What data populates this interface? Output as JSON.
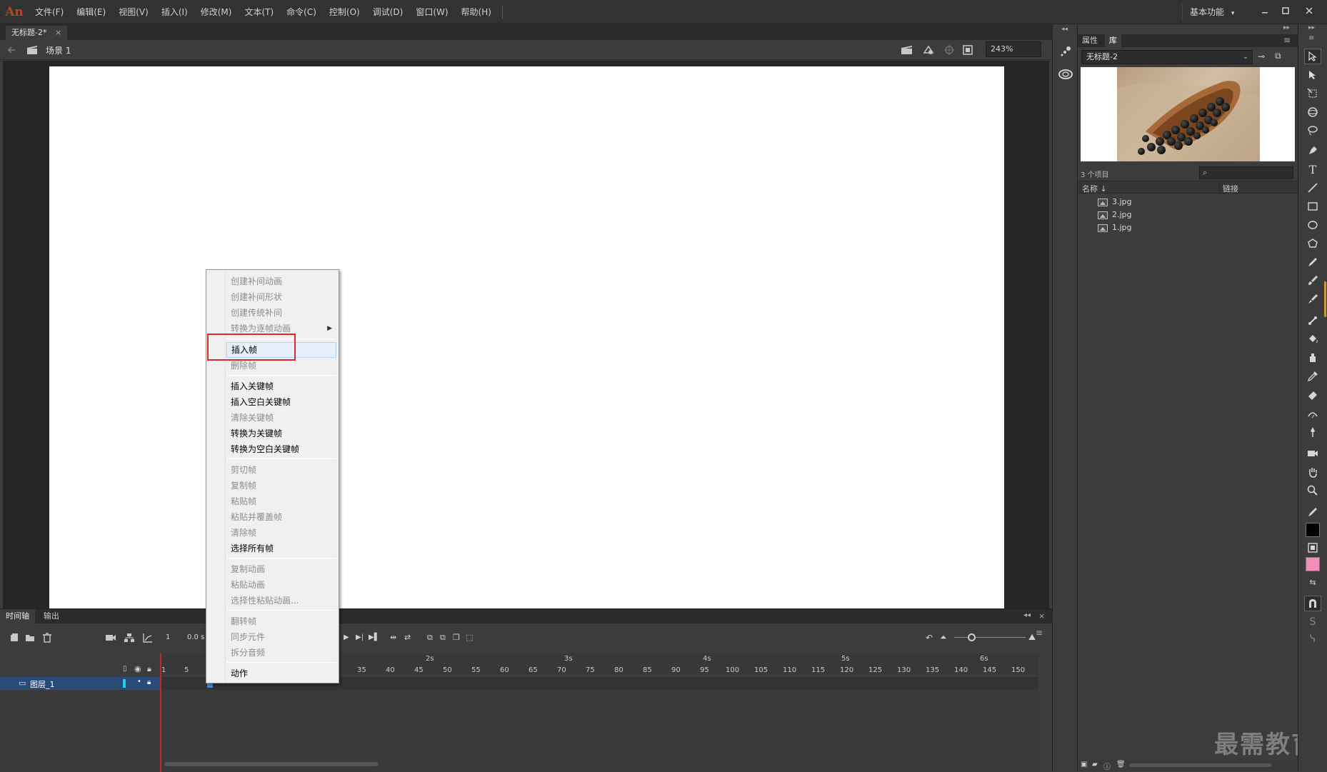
{
  "app": {
    "logo": "An",
    "accent": "#b7452c"
  },
  "menubar": {
    "items": [
      "文件(F)",
      "编辑(E)",
      "视图(V)",
      "插入(I)",
      "修改(M)",
      "文本(T)",
      "命令(C)",
      "控制(O)",
      "调试(D)",
      "窗口(W)",
      "帮助(H)"
    ],
    "workspace": "基本功能",
    "workspace_arrow": "▾"
  },
  "document": {
    "tab_title": "无标题-2*",
    "tab_close": "×",
    "scene_label": "场景 1",
    "zoom": "243%"
  },
  "timeline": {
    "tabs": [
      "时间轴",
      "输出"
    ],
    "current_frame": "1",
    "fps_time": "0.0 s",
    "layer_name": "图层_1",
    "ruler_numbers": [
      "1",
      "5",
      "35",
      "40",
      "45",
      "50",
      "55",
      "60",
      "65",
      "70",
      "75",
      "80",
      "85",
      "90",
      "95",
      "100",
      "105",
      "110",
      "115",
      "120",
      "125",
      "130",
      "135",
      "140",
      "145",
      "150"
    ],
    "ruler_seconds": [
      "2s",
      "3s",
      "4s",
      "5s",
      "6s"
    ]
  },
  "library": {
    "tabs": [
      "属性",
      "库"
    ],
    "doc_select": "无标题-2",
    "count": "3 个项目",
    "col_name": "名称",
    "col_sort": "↓",
    "col_link": "链接",
    "items": [
      "3.jpg",
      "2.jpg",
      "1.jpg"
    ]
  },
  "context_menu": {
    "items": [
      {
        "label": "创建补间动画",
        "disabled": true
      },
      {
        "label": "创建补间形状",
        "disabled": true
      },
      {
        "label": "创建传统补间",
        "disabled": true
      },
      {
        "label": "转换为逐帧动画",
        "disabled": true,
        "submenu": true
      },
      {
        "label": "插入帧",
        "disabled": false,
        "highlight": true
      },
      {
        "label": "删除帧",
        "disabled": true
      },
      {
        "label": "插入关键帧",
        "disabled": false
      },
      {
        "label": "插入空白关键帧",
        "disabled": false
      },
      {
        "label": "清除关键帧",
        "disabled": true
      },
      {
        "label": "转换为关键帧",
        "disabled": false
      },
      {
        "label": "转换为空白关键帧",
        "disabled": false
      },
      {
        "label": "剪切帧",
        "disabled": true
      },
      {
        "label": "复制帧",
        "disabled": true
      },
      {
        "label": "粘贴帧",
        "disabled": true
      },
      {
        "label": "粘贴并覆盖帧",
        "disabled": true
      },
      {
        "label": "清除帧",
        "disabled": true
      },
      {
        "label": "选择所有帧",
        "disabled": false
      },
      {
        "label": "复制动画",
        "disabled": true
      },
      {
        "label": "粘贴动画",
        "disabled": true
      },
      {
        "label": "选择性粘贴动画...",
        "disabled": true
      },
      {
        "label": "翻转帧",
        "disabled": true
      },
      {
        "label": "同步元件",
        "disabled": true
      },
      {
        "label": "拆分音频",
        "disabled": true
      },
      {
        "label": "动作",
        "disabled": false
      }
    ],
    "highlight_color": "#e0272a"
  },
  "watermark": "最需教育"
}
